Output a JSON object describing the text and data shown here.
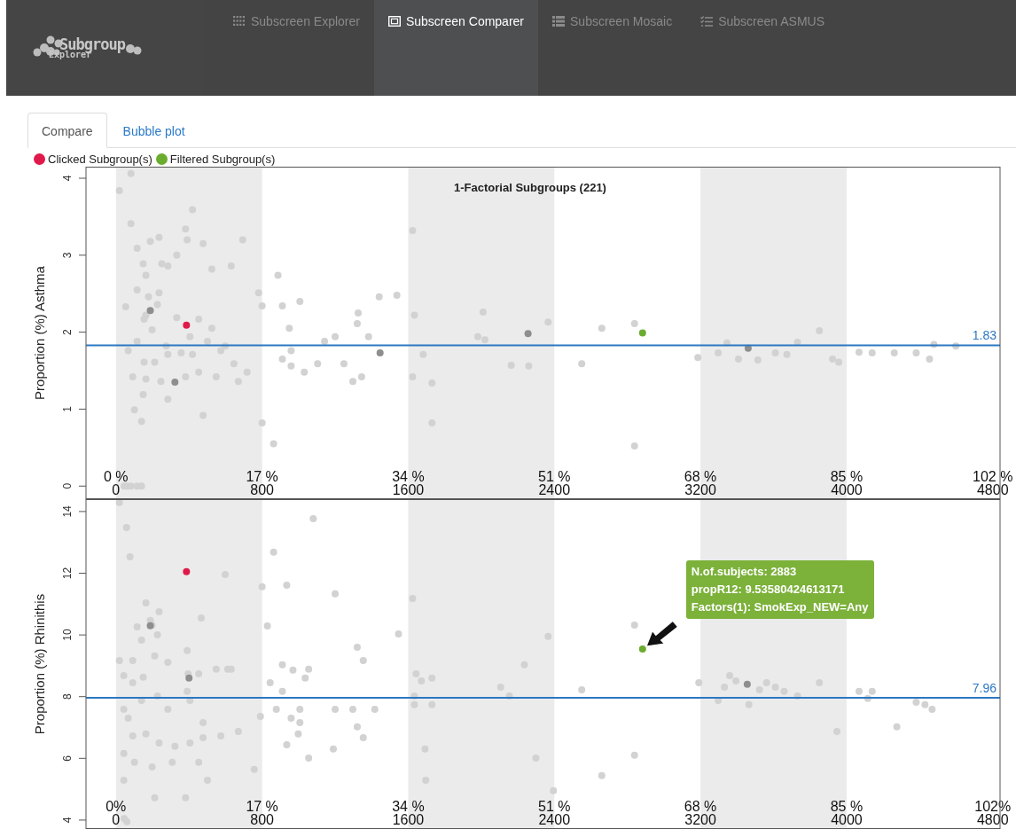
{
  "header": {
    "logo": {
      "title": "Subgroup",
      "subtitle": "Explorer"
    },
    "nav": [
      {
        "label": "Subscreen Explorer",
        "kind": "dots",
        "selected": false
      },
      {
        "label": "Subscreen Comparer",
        "kind": "frame",
        "selected": true
      },
      {
        "label": "Subscreen Mosaic",
        "kind": "list",
        "selected": false
      },
      {
        "label": "Subscreen ASMUS",
        "kind": "checklist",
        "selected": false
      }
    ]
  },
  "tabs": [
    {
      "label": "Compare",
      "selected": true
    },
    {
      "label": "Bubble plot",
      "selected": false
    }
  ],
  "legend": [
    {
      "label": "Clicked Subgroup(s)",
      "color": "#e0194a"
    },
    {
      "label": "Filtered Subgroup(s)",
      "color": "#6aac2f"
    }
  ],
  "charts": [
    {
      "chart_data": {
        "type": "scatter",
        "title": "1-Factorial Subgroups (221)",
        "ylabel": "Proportion (%) Asthma",
        "xlim": [
          -164,
          4840
        ],
        "ylim": [
          -0.17,
          4.15
        ],
        "xticks": [
          {
            "value": 0,
            "label": "0"
          },
          {
            "value": 800,
            "label": "800"
          },
          {
            "value": 1600,
            "label": "1600"
          },
          {
            "value": 2400,
            "label": "2400"
          },
          {
            "value": 3200,
            "label": "3200"
          },
          {
            "value": 4000,
            "label": "4000"
          },
          {
            "value": 4800,
            "label": "4800"
          }
        ],
        "yticks": [
          0,
          1,
          2,
          3,
          4
        ],
        "series": [
          {
            "color": "#d2d2d2",
            "x": [
              19,
              82,
              82,
              116,
              149,
              188,
              236,
              251,
              284,
              333,
              381,
              390,
              419,
              477,
              525,
              631,
              694,
              116,
              164,
              178,
              236,
              154,
              227,
              53,
              164,
              198,
              275,
              333,
              405,
              453,
              525,
              598,
              67,
              116,
              154,
              212,
              284,
              357,
              419,
              501,
              574,
              646,
              718,
              92,
              164,
              246,
              381,
              453,
              549,
              670,
              149,
              284,
              477,
              101,
              140,
              800,
              863,
              781,
              800,
              887,
              911,
              1007,
              949,
              959,
              911,
              959,
              1031,
              1104,
              1142,
              1200,
              1248,
              1297,
              1345,
              1383,
              1441,
              1538,
              1326,
              1321,
              1624,
              1634,
              1682,
              1624,
              1730,
              1730,
              2010,
              1981,
              2020,
              2164,
              2260,
              2366,
              2550,
              2660,
              2839,
              2839,
              3186,
              3297,
              3345,
              3408,
              3514,
              3610,
              3673,
              3731,
              3851,
              3923,
              3957,
              4068,
              4140,
              4261,
              4381,
              4454,
              4478,
              4598,
              45,
              60,
              82,
              116,
              140
            ],
            "values": [
              3.84,
              4.06,
              3.41,
              3.09,
              2.89,
              3.18,
              3.23,
              2.89,
              2.86,
              3.0,
              3.34,
              3.2,
              3.59,
              3.15,
              2.82,
              2.86,
              3.2,
              2.55,
              2.74,
              2.46,
              2.51,
              2.17,
              2.36,
              2.33,
              2.22,
              2.03,
              1.82,
              2.19,
              1.94,
              2.17,
              2.05,
              1.82,
              1.76,
              1.88,
              1.61,
              1.61,
              1.71,
              1.73,
              1.71,
              1.88,
              1.76,
              1.59,
              1.48,
              1.42,
              1.39,
              1.36,
              1.42,
              1.48,
              1.42,
              1.36,
              1.19,
              1.13,
              0.92,
              0.99,
              0.84,
              0.82,
              0.55,
              2.51,
              2.34,
              2.74,
              2.34,
              2.4,
              2.05,
              1.76,
              1.65,
              1.56,
              1.48,
              1.59,
              1.88,
              1.94,
              1.59,
              1.36,
              1.42,
              1.94,
              2.46,
              2.48,
              2.25,
              2.11,
              3.32,
              2.22,
              1.71,
              1.42,
              1.34,
              0.82,
              2.26,
              1.94,
              1.9,
              1.57,
              1.56,
              2.13,
              1.59,
              2.05,
              2.11,
              0.52,
              1.67,
              1.73,
              1.86,
              1.65,
              1.64,
              1.73,
              1.71,
              1.87,
              2.02,
              1.65,
              1.61,
              1.74,
              1.73,
              1.73,
              1.73,
              1.65,
              1.84,
              1.82,
              0,
              0,
              0,
              0,
              0
            ]
          },
          {
            "color": "#8e8e8e",
            "x": [
              323,
              1446,
              2256,
              3461,
              188
            ],
            "values": [
              1.35,
              1.73,
              1.98,
              1.79,
              2.28
            ]
          },
          {
            "color": "#e0194a",
            "x": [
              386
            ],
            "values": [
              2.09
            ]
          },
          {
            "color": "#6aac2f",
            "x": [
              2883
            ],
            "values": [
              1.99
            ]
          }
        ],
        "bands": [
          {
            "axis": "x",
            "from": 0,
            "to": 800
          },
          {
            "axis": "x",
            "from": 1600,
            "to": 2400
          },
          {
            "axis": "x",
            "from": 3200,
            "to": 4000
          }
        ],
        "ref_lines": [
          {
            "axis": "y",
            "value": 1.83,
            "label": "1.83",
            "color": "#2b78c2"
          }
        ],
        "annotations": [
          "0 %",
          "17 %",
          "34 %",
          "51 %",
          "68 %",
          "85 %",
          "102 %"
        ]
      }
    },
    {
      "chart_data": {
        "type": "scatter",
        "ylabel": "Proportion (%) Rhinithis",
        "xlim": [
          -164,
          4840
        ],
        "ylim": [
          3.71,
          14.4
        ],
        "xticks": [
          {
            "value": 0,
            "label": "0"
          },
          {
            "value": 800,
            "label": "800"
          },
          {
            "value": 1600,
            "label": "1600"
          },
          {
            "value": 2400,
            "label": "2400"
          },
          {
            "value": 3200,
            "label": "3200"
          },
          {
            "value": 4000,
            "label": "4000"
          },
          {
            "value": 4800,
            "label": "4800"
          }
        ],
        "yticks": [
          4,
          6,
          8,
          10,
          12,
          14
        ],
        "series": [
          {
            "color": "#d2d2d2",
            "x": [
              19,
              58,
              77,
              116,
              164,
              188,
              140,
              212,
              19,
              43,
              92,
              149,
              236,
              227,
              198,
              92,
              284,
              390,
              395,
              390,
              453,
              467,
              549,
              612,
              631,
              598,
              43,
              67,
              140,
              227,
              284,
              405,
              477,
              92,
              164,
              236,
              323,
              405,
              477,
              574,
              670,
              43,
              101,
              198,
              308,
              453,
              43,
              212,
              45,
              60,
              381,
              501,
              757,
              800,
              829,
              863,
              935,
              911,
              969,
              1055,
              1036,
              911,
              878,
              1007,
              959,
              844,
              791,
              935,
              1007,
              998,
              1055,
              1200,
              1190,
              1080,
              1200,
              1321,
              1354,
              1297,
              1321,
              1354,
              1417,
              1547,
              1624,
              1643,
              1672,
              1730,
              1634,
              1634,
              1730,
              1692,
              1696,
              2106,
              2154,
              2236,
              2366,
              2299,
              2395,
              2550,
              2660,
              2839,
              2839,
              3191,
              3297,
              3331,
              3360,
              3394,
              3465,
              3523,
              3562,
              3610,
              3658,
              3731,
              3851,
              3947,
              4068,
              4116,
              4140,
              4275,
              4381,
              4429,
              4468
            ],
            "values": [
              14.29,
              13.48,
              12.53,
              10.26,
              11.04,
              10.47,
              9.83,
              9.32,
              9.17,
              8.68,
              8.45,
              8.63,
              10.75,
              10.0,
              10.32,
              9.17,
              9.11,
              9.49,
              8.74,
              8.17,
              8.74,
              10.55,
              8.89,
              8.89,
              8.89,
              11.96,
              7.59,
              7.3,
              7.88,
              8.02,
              7.59,
              7.88,
              7.16,
              6.73,
              6.79,
              6.5,
              6.39,
              6.5,
              6.67,
              6.73,
              6.87,
              6.16,
              5.87,
              5.72,
              5.87,
              5.87,
              5.29,
              4.72,
              4.05,
              3.95,
              4.72,
              5.29,
              5.64,
              11.56,
              10.29,
              12.68,
              11.61,
              9.03,
              8.86,
              8.89,
              8.6,
              8.17,
              7.59,
              7.59,
              7.3,
              8.45,
              7.36,
              6.44,
              7.16,
              6.79,
              6.01,
              7.59,
              6.3,
              13.77,
              11.33,
              9.6,
              9.17,
              7.59,
              7.02,
              6.67,
              7.59,
              10.03,
              11.18,
              8.74,
              8.51,
              8.6,
              8.02,
              7.74,
              7.74,
              6.3,
              5.29,
              8.31,
              8.02,
              9.03,
              9.95,
              6.01,
              4.95,
              8.22,
              5.44,
              10.32,
              6.1,
              8.45,
              7.88,
              8.31,
              8.68,
              8.51,
              7.74,
              8.22,
              8.45,
              8.31,
              8.17,
              8.02,
              8.45,
              6.87,
              8.17,
              7.94,
              8.17,
              7.02,
              7.82,
              7.74,
              7.59
            ]
          },
          {
            "color": "#8e8e8e",
            "x": [
              3456,
              400,
              188
            ],
            "values": [
              8.4,
              8.6,
              10.3
            ]
          },
          {
            "color": "#e0194a",
            "x": [
              386
            ],
            "values": [
              12.05
            ]
          },
          {
            "color": "#6aac2f",
            "x": [
              2883
            ],
            "values": [
              9.54
            ]
          }
        ],
        "bands": [
          {
            "axis": "x",
            "from": 0,
            "to": 800
          },
          {
            "axis": "x",
            "from": 1600,
            "to": 2400
          },
          {
            "axis": "x",
            "from": 3200,
            "to": 4000
          }
        ],
        "ref_lines": [
          {
            "axis": "y",
            "value": 7.96,
            "label": "7.96",
            "color": "#2b78c2"
          }
        ],
        "annotations": [
          "0%",
          "17 %",
          "34 %",
          "51 %",
          "68 %",
          "85 %",
          "102%"
        ]
      },
      "tooltip": {
        "color": "#7cb13a",
        "lines": [
          "N.of.subjects: 2883",
          "propR12: 9.53580424613171",
          "Factors(1): SmokExp_NEW=Any"
        ]
      }
    }
  ]
}
